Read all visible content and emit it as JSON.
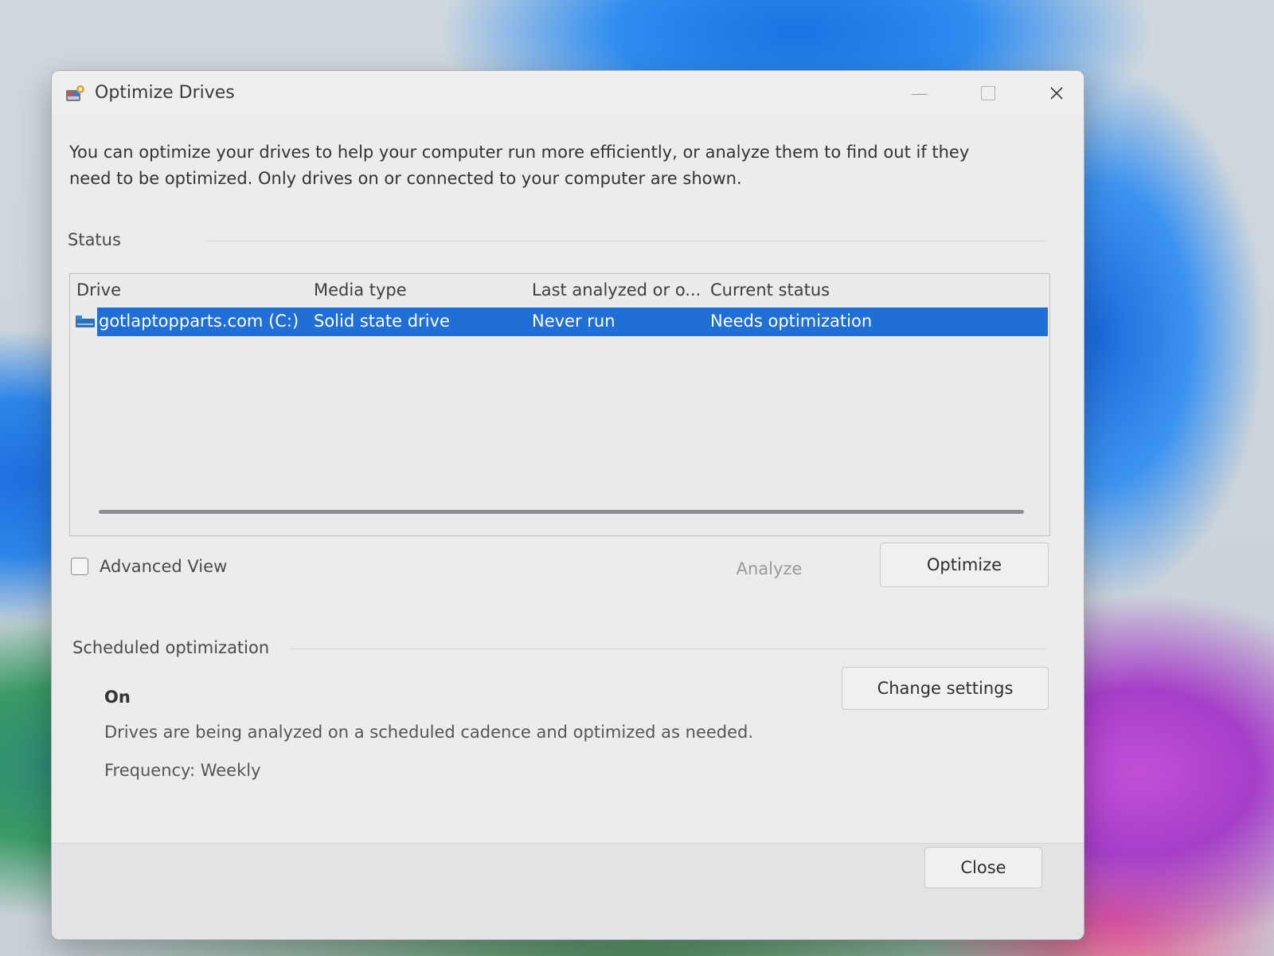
{
  "window": {
    "title": "Optimize Drives",
    "minimize_icon": "minimize-icon",
    "maximize_icon": "maximize-icon",
    "close_glyph": "✕"
  },
  "intro_text": "You can optimize your drives to help your computer run more efficiently, or analyze them to find out if they need to be optimized. Only drives on or connected to your computer are shown.",
  "status": {
    "label": "Status",
    "columns": {
      "drive": "Drive",
      "media_type": "Media type",
      "last_analyzed": "Last analyzed or o...",
      "current_status": "Current status"
    },
    "rows": [
      {
        "drive": "gotlaptopparts.com (C:)",
        "media_type": "Solid state drive",
        "last_analyzed": "Never run",
        "current_status": "Needs optimization",
        "selected": true,
        "icon": "drive-icon"
      }
    ]
  },
  "advanced_view": {
    "label": "Advanced View",
    "checked": false
  },
  "buttons": {
    "analyze": "Analyze",
    "optimize": "Optimize",
    "change_settings": "Change settings",
    "close": "Close"
  },
  "scheduled": {
    "label": "Scheduled optimization",
    "state": "On",
    "description": "Drives are being analyzed on a scheduled cadence and optimized as needed.",
    "frequency": "Frequency: Weekly"
  },
  "colors": {
    "selection": "#1f6fd6",
    "window_bg": "#ececed"
  }
}
